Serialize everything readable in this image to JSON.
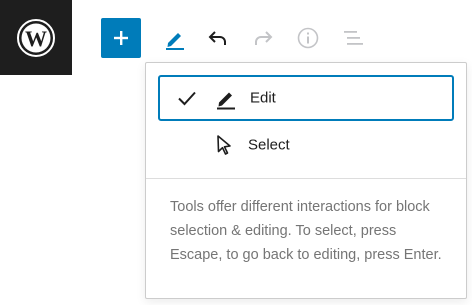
{
  "toolbar": {
    "logo_icon": "wordpress-logo-icon",
    "add_icon": "plus-icon",
    "edit_icon": "pencil-icon",
    "undo_icon": "undo-icon",
    "redo_icon": "redo-icon",
    "info_icon": "info-icon",
    "outline_icon": "list-view-icon"
  },
  "tools_menu": {
    "items": [
      {
        "label": "Edit",
        "icon": "pencil-icon",
        "selected": true
      },
      {
        "label": "Select",
        "icon": "cursor-pointer-icon",
        "selected": false
      }
    ],
    "help_text": "Tools offer different interactions for block selection & editing. To select, press Escape, to go back to editing, press Enter."
  },
  "colors": {
    "accent": "#007cba",
    "logo_background": "#1e1e1e",
    "text": "#1e1e1e",
    "muted_text": "#757575",
    "disabled_icon": "#c3c4c7"
  }
}
